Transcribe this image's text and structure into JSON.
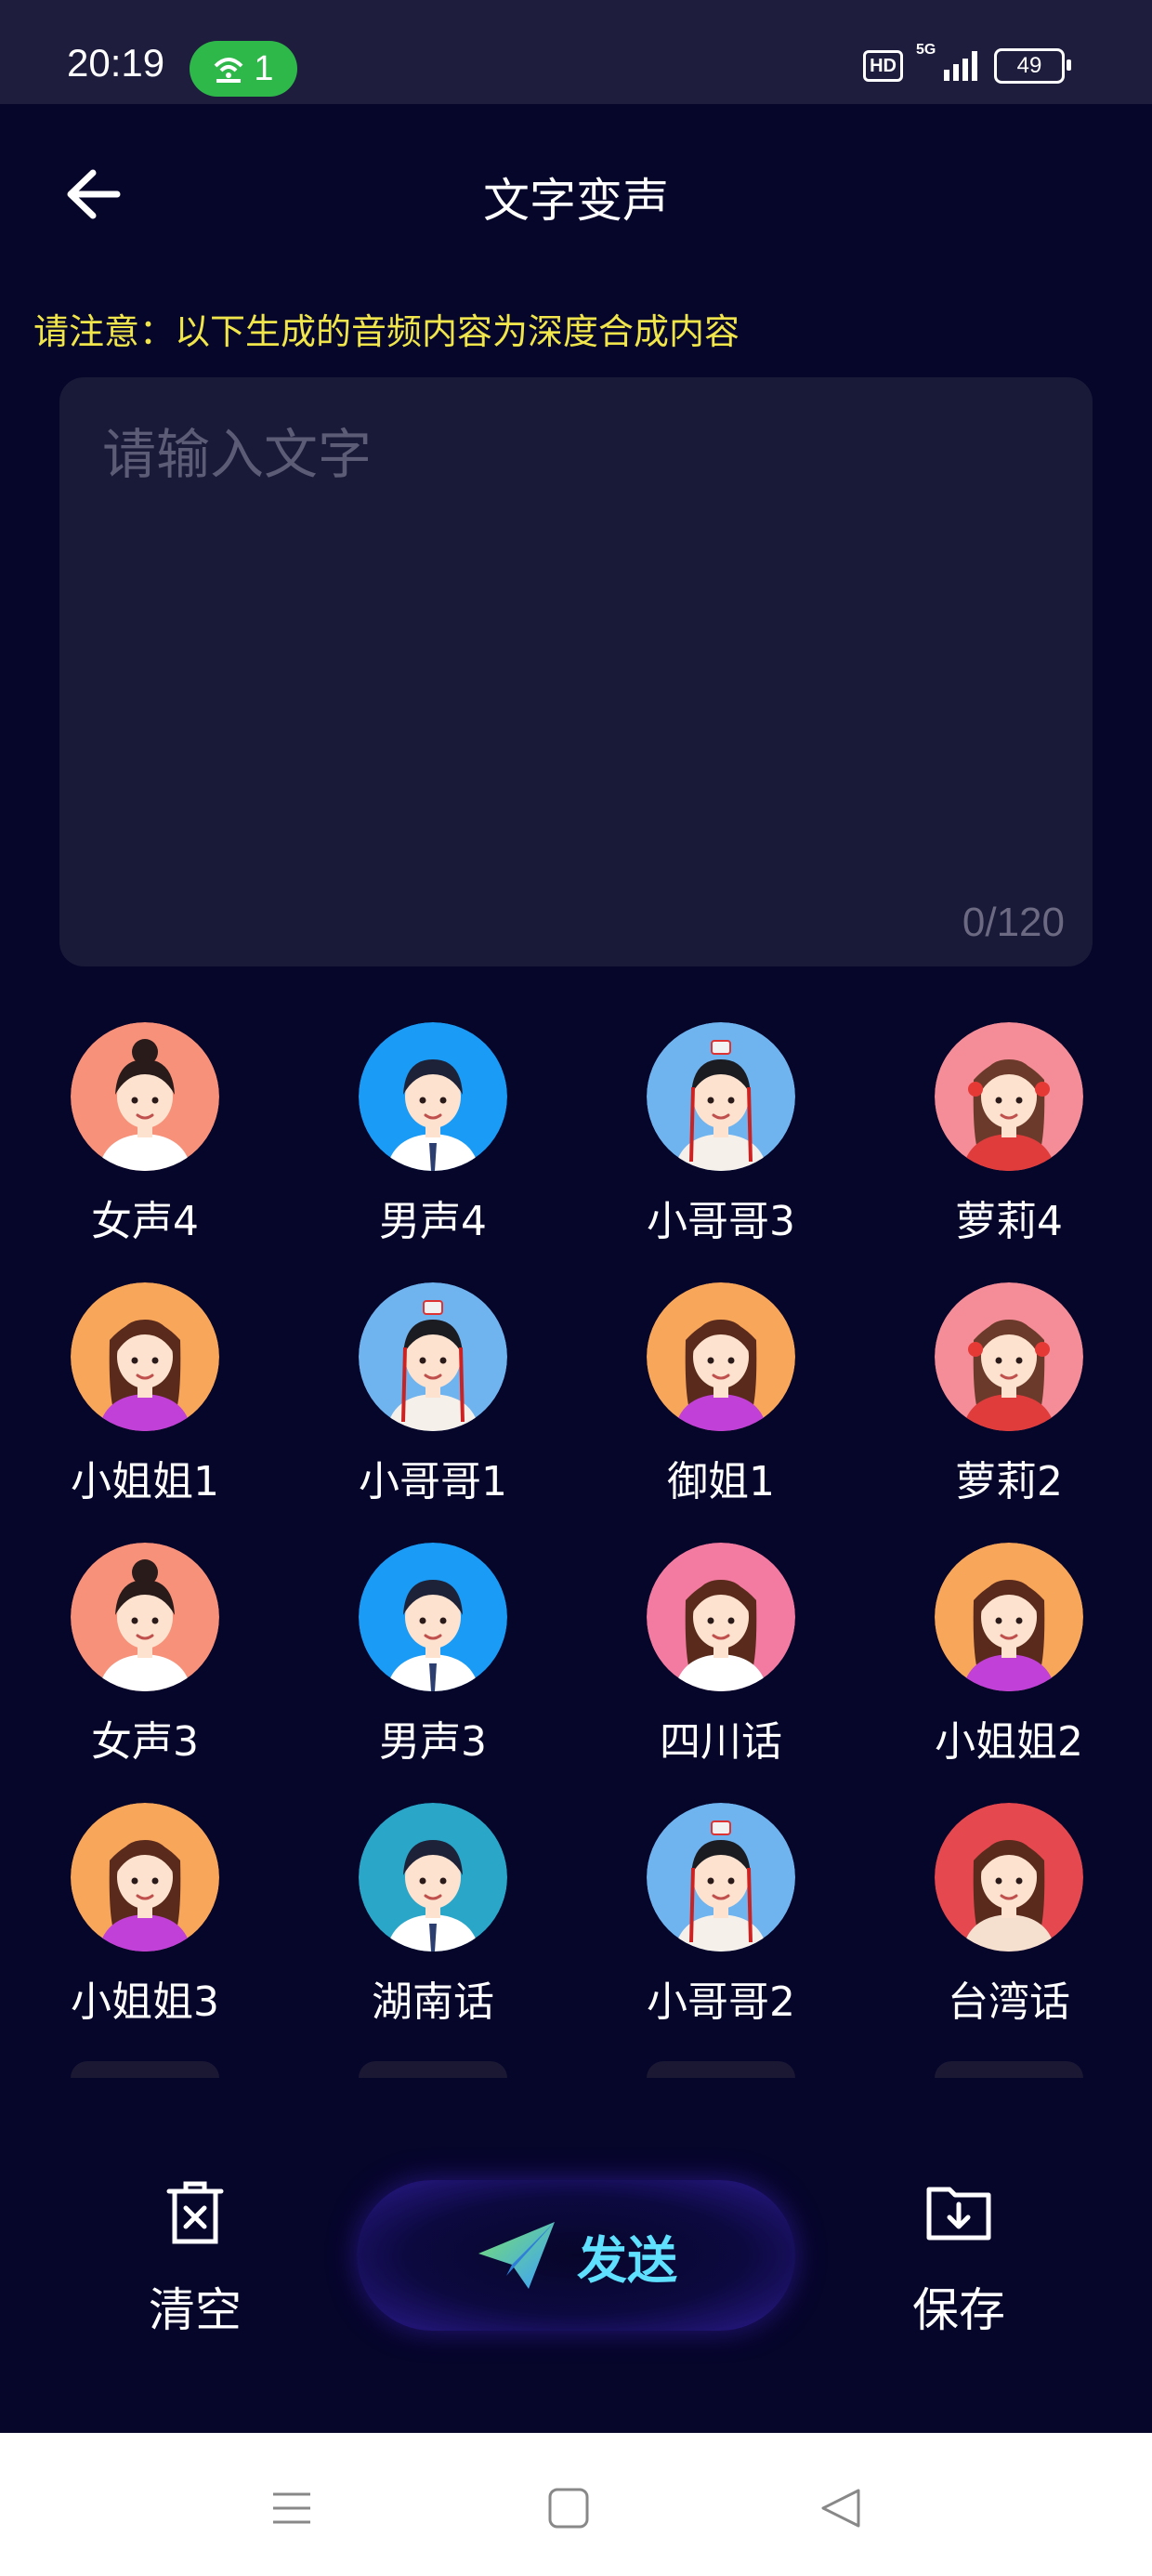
{
  "status_bar": {
    "time": "20:19",
    "hotspot_count": "1",
    "hd_label": "HD",
    "network": "5G",
    "battery": "49"
  },
  "header": {
    "title": "文字变声",
    "back_icon": "arrow-left-icon"
  },
  "notice": "请注意：以下生成的音频内容为深度合成内容",
  "text_input": {
    "placeholder": "请输入文字",
    "counter": "0/120"
  },
  "voices": [
    {
      "label": "女声4",
      "avatar": "female-bun",
      "bg": "#f7917a"
    },
    {
      "label": "男声4",
      "avatar": "male-suit",
      "bg": "#1a9bf5"
    },
    {
      "label": "小哥哥3",
      "avatar": "ancient-boy",
      "bg": "#6fb3ef"
    },
    {
      "label": "萝莉4",
      "avatar": "loli",
      "bg": "#f48d97"
    },
    {
      "label": "小姐姐1",
      "avatar": "long-hair-girl",
      "bg": "#f8a65a"
    },
    {
      "label": "小哥哥1",
      "avatar": "ancient-boy",
      "bg": "#6fb3ef"
    },
    {
      "label": "御姐1",
      "avatar": "long-hair-girl",
      "bg": "#f8a65a"
    },
    {
      "label": "萝莉2",
      "avatar": "loli",
      "bg": "#f48d97"
    },
    {
      "label": "女声3",
      "avatar": "female-bun",
      "bg": "#f7917a"
    },
    {
      "label": "男声3",
      "avatar": "male-suit",
      "bg": "#1a9bf5"
    },
    {
      "label": "四川话",
      "avatar": "sichuan-girl",
      "bg": "#f37aa0"
    },
    {
      "label": "小姐姐2",
      "avatar": "long-hair-girl",
      "bg": "#f8a65a"
    },
    {
      "label": "小姐姐3",
      "avatar": "long-hair-girl",
      "bg": "#f8a65a"
    },
    {
      "label": "湖南话",
      "avatar": "hunan-boy",
      "bg": "#2aa6c9"
    },
    {
      "label": "小哥哥2",
      "avatar": "ancient-boy",
      "bg": "#6fb3ef"
    },
    {
      "label": "台湾话",
      "avatar": "taiwan-girl",
      "bg": "#e5484f"
    }
  ],
  "bottom_actions": {
    "clear_label": "清空",
    "clear_icon": "trash-x-icon",
    "send_label": "发送",
    "send_icon": "paper-plane-icon",
    "save_label": "保存",
    "save_icon": "folder-download-icon"
  },
  "nav": {
    "menu_icon": "menu-icon",
    "home_icon": "home-square-icon",
    "back_icon": "back-triangle-icon"
  },
  "colors": {
    "background": "#06052a",
    "status_bar": "#1e1d3d",
    "input_bg": "#191938",
    "notice": "#f0e64c",
    "send_text": "#5fe0ff",
    "hotspot_pill": "#2fb84a"
  }
}
